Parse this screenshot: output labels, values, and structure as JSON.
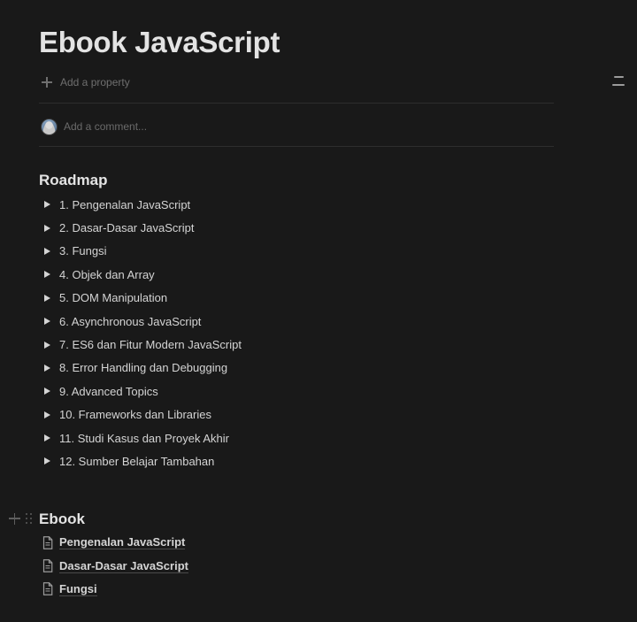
{
  "page": {
    "title": "Ebook JavaScript",
    "add_property_label": "Add a property",
    "comment_placeholder": "Add a comment..."
  },
  "icons": {
    "add_property": "plus-icon",
    "table_of_contents": "toc-icon",
    "avatar": "user-avatar",
    "toggle": "triangle-right-icon",
    "page": "document-icon",
    "block_add": "plus-icon",
    "block_drag": "drag-handle-icon"
  },
  "roadmap": {
    "heading": "Roadmap",
    "items": [
      "1. Pengenalan JavaScript",
      "2. Dasar-Dasar JavaScript",
      "3. Fungsi",
      "4. Objek dan Array",
      "5. DOM Manipulation",
      "6. Asynchronous JavaScript",
      "7. ES6 dan Fitur Modern JavaScript",
      "8. Error Handling dan Debugging",
      "9. Advanced Topics",
      "10. Frameworks dan Libraries",
      "11. Studi Kasus dan Proyek Akhir",
      "12. Sumber Belajar Tambahan"
    ]
  },
  "ebook": {
    "heading": "Ebook",
    "pages": [
      "Pengenalan JavaScript",
      "Dasar-Dasar JavaScript",
      "Fungsi"
    ]
  }
}
